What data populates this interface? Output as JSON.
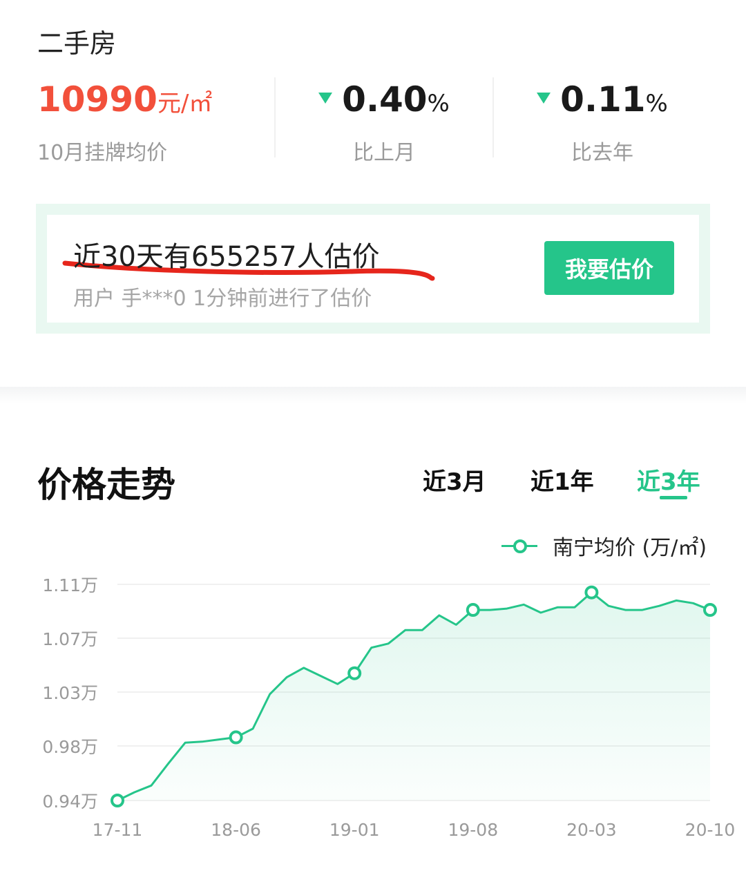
{
  "header": {
    "title": "二手房"
  },
  "stats": {
    "price_value": "10990",
    "price_unit": "元/㎡",
    "price_label": "10月挂牌均价",
    "mom_value": "0.40",
    "mom_unit": "%",
    "mom_label": "比上月",
    "yoy_value": "0.11",
    "yoy_unit": "%",
    "yoy_label": "比去年"
  },
  "evaluation": {
    "title": "近30天有655257人估价",
    "subtitle": "用户 手***0 1分钟前进行了估价",
    "button_label": "我要估价"
  },
  "trend": {
    "title": "价格走势",
    "tabs": [
      {
        "label": "近3月",
        "active": false
      },
      {
        "label": "近1年",
        "active": false
      },
      {
        "label": "近3年",
        "active": true
      }
    ],
    "legend_label": "南宁均价 (万/㎡)"
  },
  "colors": {
    "accent": "#25c58a",
    "price_red": "#f2503b",
    "annotation_red": "#e6261c"
  },
  "chart_data": {
    "type": "area",
    "ylabel": "",
    "xlabel": "",
    "ylim": [
      0.94,
      1.11
    ],
    "y_ticks": [
      {
        "value": 1.11,
        "label": "1.11万"
      },
      {
        "value": 1.07,
        "label": "1.07万"
      },
      {
        "value": 1.03,
        "label": "1.03万"
      },
      {
        "value": 0.98,
        "label": "0.98万"
      },
      {
        "value": 0.94,
        "label": "0.94万"
      }
    ],
    "x_ticks": [
      "17-11",
      "18-06",
      "19-01",
      "19-08",
      "20-03",
      "20-10"
    ],
    "grid": true,
    "legend_position": "top-right",
    "series": [
      {
        "name": "南宁均价 (万/㎡)",
        "values": [
          0.94,
          0.946,
          0.951,
          0.967,
          0.983,
          0.984,
          0.986,
          0.988,
          0.996,
          1.028,
          1.041,
          1.048,
          1.042,
          1.036,
          1.044,
          1.063,
          1.066,
          1.076,
          1.076,
          1.087,
          1.08,
          1.091,
          1.091,
          1.092,
          1.095,
          1.089,
          1.093,
          1.093,
          1.104,
          1.094,
          1.091,
          1.091,
          1.094,
          1.098,
          1.096,
          1.091
        ],
        "marker_indices": [
          0,
          7,
          14,
          21,
          28,
          35
        ]
      }
    ]
  }
}
